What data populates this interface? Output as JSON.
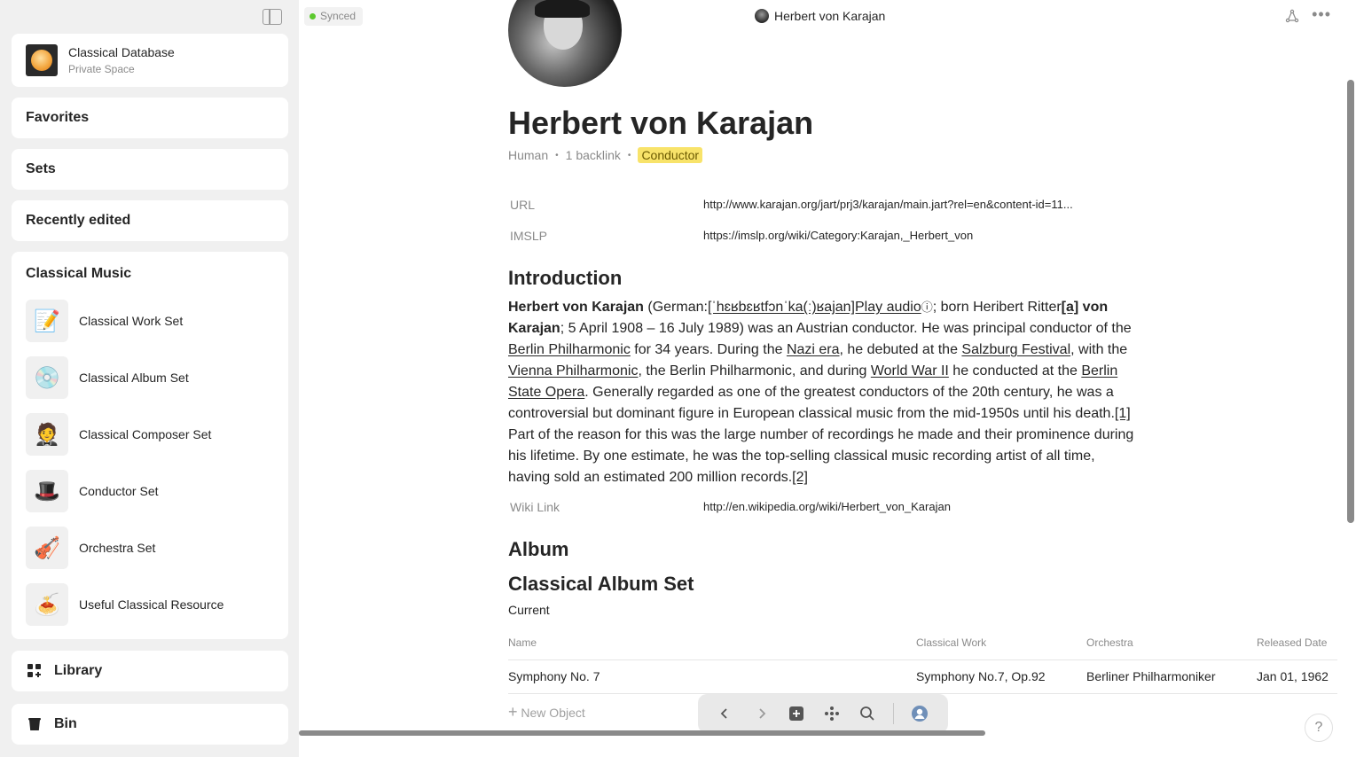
{
  "sidebar": {
    "space": {
      "name": "Classical Database",
      "subtitle": "Private Space"
    },
    "nav": {
      "favorites": "Favorites",
      "sets": "Sets",
      "recently_edited": "Recently edited",
      "library": "Library",
      "bin": "Bin"
    },
    "widget": {
      "title": "Classical Music",
      "items": [
        {
          "label": "Classical Work Set",
          "icon": "📝"
        },
        {
          "label": "Classical Album Set",
          "icon": "💿"
        },
        {
          "label": "Classical Composer Set",
          "icon": "🤵"
        },
        {
          "label": "Conductor Set",
          "icon": "🎩"
        },
        {
          "label": "Orchestra Set",
          "icon": "🎻"
        },
        {
          "label": "Useful Classical Resource",
          "icon": "🍝"
        }
      ]
    }
  },
  "header": {
    "sync_status": "Synced",
    "title": "Herbert von Karajan"
  },
  "object": {
    "title": "Herbert von Karajan",
    "type": "Human",
    "backlinks": "1 backlink",
    "tag": "Conductor",
    "relations": {
      "url_label": "URL",
      "url_value": "http://www.karajan.org/jart/prj3/karajan/main.jart?rel=en&content-id=11...",
      "imslp_label": "IMSLP",
      "imslp_value": "https://imslp.org/wiki/Category:Karajan,_Herbert_von",
      "wiki_label": "Wiki Link",
      "wiki_value": "http://en.wikipedia.org/wiki/Herbert_von_Karajan"
    },
    "intro_heading": "Introduction",
    "intro": {
      "name": "Herbert von Karajan",
      "t1": " (German:",
      "ipa": "[ˈhɛʁbɛʁtfɔnˈka(ː)ʁajan]Play audio",
      "t2": "; born Heribert Ritter",
      "note_a": "[a]",
      "name2": " von Karajan",
      "t3": "; 5 April 1908 – 16 July 1989) was an Austrian conductor. He was principal conductor of the ",
      "link1": "Berlin Philharmonic",
      "t4": " for 34 years. During the ",
      "link2": "Nazi era",
      "t5": ", he debuted at the ",
      "link3": "Salzburg Festival",
      "t6": ", with the ",
      "link4": "Vienna Philharmonic",
      "t7": ", the Berlin Philharmonic, and during ",
      "link5": "World War II",
      "t8": " he conducted at the ",
      "link6": "Berlin State Opera",
      "t9": ". Generally regarded as one of the greatest conductors of the 20th century, he was a controversial but dominant figure in European classical music from the mid-1950s until his death.",
      "ref1": "[1]",
      "t10": " Part of the reason for this was the large number of recordings he made and their prominence during his lifetime. By one estimate, he was the top-selling classical music recording artist of all time, having sold an estimated 200 million records.",
      "ref2": "[2]"
    },
    "album_heading": "Album",
    "album_set": {
      "title": "Classical Album Set",
      "view": "Current",
      "columns": [
        "Name",
        "Classical Work",
        "Orchestra",
        "Released Date"
      ],
      "rows": [
        [
          "Symphony No. 7",
          "Symphony No.7, Op.92",
          "Berliner Philharmoniker",
          "Jan 01, 1962"
        ]
      ],
      "new_object": "New Object"
    }
  },
  "help": "?"
}
